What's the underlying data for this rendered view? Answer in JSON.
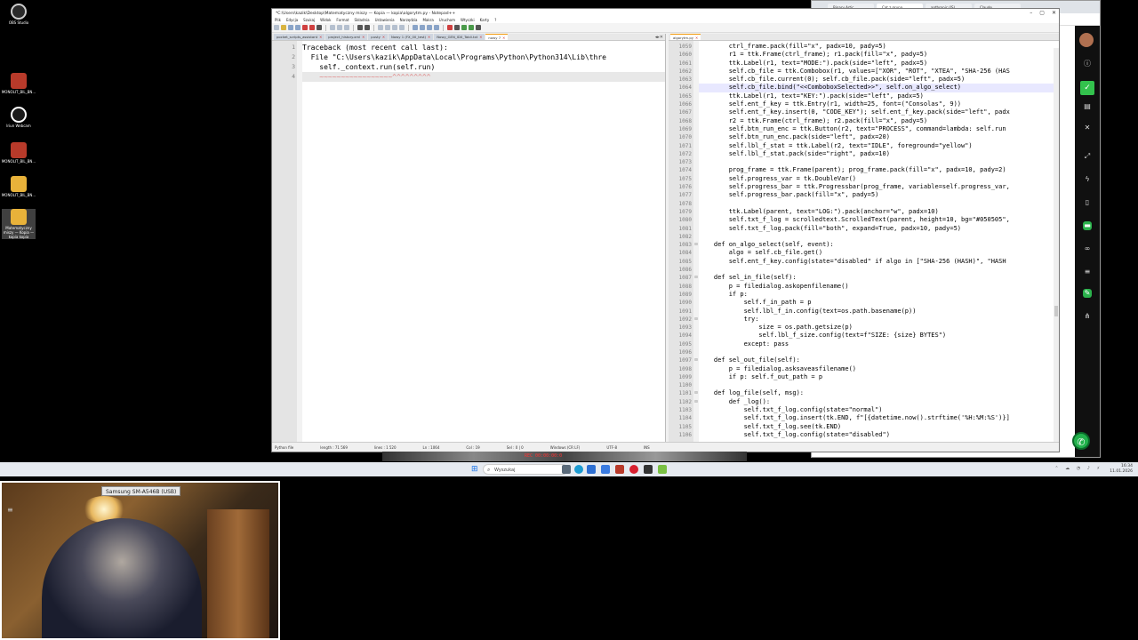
{
  "desktop": {
    "icons": [
      {
        "label": "OBS Studio",
        "color": "#2a2a2a"
      },
      {
        "label": "MONOLIT_BIL_BN...",
        "color": "#b83a2a"
      },
      {
        "label": "Iriun Webcam",
        "color": "#1a1a1a"
      },
      {
        "label": "MONOLIT_BIL_BN...",
        "color": "#b83a2a"
      },
      {
        "label": "MONOLIT_BIL_BN...",
        "color": "#e8b23a"
      },
      {
        "label": "Matematyczny miszy — Kopia — kopia kopia",
        "color": "#e8b23a"
      }
    ]
  },
  "browser": {
    "tabs": [
      "Binary Artic",
      "Cat z grupa",
      "anthropic (JS)",
      "Claude"
    ],
    "sidebar_icons": [
      "info-icon",
      "checkmark-icon",
      "notes-icon",
      "close-icon",
      "expand-icon",
      "bolt-icon",
      "doc-icon",
      "chat-icon",
      "glasses-icon",
      "list-icon",
      "wrench-icon",
      "share-icon"
    ]
  },
  "notepad": {
    "title": "*C:\\Users\\kazik\\Desktop\\Matematyczny miszy — Kopia — kopia\\algorytm.py - Notepad++",
    "menu": [
      "Plik",
      "Edycja",
      "Szukaj",
      "Widok",
      "Format",
      "Składnia",
      "Ustawienia",
      "Narzędzia",
      "Makra",
      "Uruchom",
      "Wtyczki",
      "Karty",
      "?"
    ],
    "left_tabs": [
      "pocket_scripts_assistant",
      "project_history.xml",
      "pusty",
      "Nowy 1 (FX_00_test)",
      "Nowy_GEN_IDX_Tabli.txt",
      "nowy 7"
    ],
    "right_tabs": [
      "algorytm.py"
    ],
    "left_lines": [
      {
        "n": "1",
        "t": "Traceback (most recent call last):"
      },
      {
        "n": "2",
        "t": "  File \"C:\\Users\\kazik\\AppData\\Local\\Programs\\Python\\Python314\\Lib\\thre"
      },
      {
        "n": "3",
        "t": "    self._context.run(self.run)"
      },
      {
        "n": "4",
        "t": "    ~~~~~~~~~~~~~~~~~^^^^^^^^^"
      }
    ],
    "right_lines": [
      {
        "n": "1059",
        "t": "        ctrl_frame.pack(fill=\"x\", padx=10, pady=5)"
      },
      {
        "n": "1060",
        "t": "        r1 = ttk.Frame(ctrl_frame); r1.pack(fill=\"x\", pady=5)"
      },
      {
        "n": "1061",
        "t": "        ttk.Label(r1, text=\"MODE:\").pack(side=\"left\", padx=5)"
      },
      {
        "n": "1062",
        "t": "        self.cb_file = ttk.Combobox(r1, values=[\"XOR\", \"ROT\", \"XTEA\", \"SHA-256 (HAS"
      },
      {
        "n": "1063",
        "t": "        self.cb_file.current(0); self.cb_file.pack(side=\"left\", padx=5)"
      },
      {
        "n": "1064",
        "t": "        self.cb_file.bind(\"<<ComboboxSelected>>\", self.on_algo_select)"
      },
      {
        "n": "1065",
        "t": "        ttk.Label(r1, text=\"KEY:\").pack(side=\"left\", padx=5)"
      },
      {
        "n": "1066",
        "t": "        self.ent_f_key = ttk.Entry(r1, width=25, font=(\"Consolas\", 9))"
      },
      {
        "n": "1067",
        "t": "        self.ent_f_key.insert(0, \"CODE_KEY\"); self.ent_f_key.pack(side=\"left\", padx"
      },
      {
        "n": "1068",
        "t": "        r2 = ttk.Frame(ctrl_frame); r2.pack(fill=\"x\", pady=5)"
      },
      {
        "n": "1069",
        "t": "        self.btn_run_enc = ttk.Button(r2, text=\"PROCESS\", command=lambda: self.run"
      },
      {
        "n": "1070",
        "t": "        self.btn_run_enc.pack(side=\"left\", padx=20)"
      },
      {
        "n": "1071",
        "t": "        self.lbl_f_stat = ttk.Label(r2, text=\"IDLE\", foreground=\"yellow\")"
      },
      {
        "n": "1072",
        "t": "        self.lbl_f_stat.pack(side=\"right\", padx=10)"
      },
      {
        "n": "1073",
        "t": ""
      },
      {
        "n": "1074",
        "t": "        prog_frame = ttk.Frame(parent); prog_frame.pack(fill=\"x\", padx=10, pady=2)"
      },
      {
        "n": "1075",
        "t": "        self.progress_var = tk.DoubleVar()"
      },
      {
        "n": "1076",
        "t": "        self.progress_bar = ttk.Progressbar(prog_frame, variable=self.progress_var,"
      },
      {
        "n": "1077",
        "t": "        self.progress_bar.pack(fill=\"x\", pady=5)"
      },
      {
        "n": "1078",
        "t": ""
      },
      {
        "n": "1079",
        "t": "        ttk.Label(parent, text=\"LOG:\").pack(anchor=\"w\", padx=10)"
      },
      {
        "n": "1080",
        "t": "        self.txt_f_log = scrolledtext.ScrolledText(parent, height=10, bg=\"#050505\","
      },
      {
        "n": "1081",
        "t": "        self.txt_f_log.pack(fill=\"both\", expand=True, padx=10, pady=5)"
      },
      {
        "n": "1082",
        "t": ""
      },
      {
        "n": "1083",
        "t": "    def on_algo_select(self, event):"
      },
      {
        "n": "1084",
        "t": "        algo = self.cb_file.get()"
      },
      {
        "n": "1085",
        "t": "        self.ent_f_key.config(state=\"disabled\" if algo in [\"SHA-256 (HASH)\", \"HASH"
      },
      {
        "n": "1086",
        "t": ""
      },
      {
        "n": "1087",
        "t": "    def sel_in_file(self):"
      },
      {
        "n": "1088",
        "t": "        p = filedialog.askopenfilename()"
      },
      {
        "n": "1089",
        "t": "        if p:"
      },
      {
        "n": "1090",
        "t": "            self.f_in_path = p"
      },
      {
        "n": "1091",
        "t": "            self.lbl_f_in.config(text=os.path.basename(p))"
      },
      {
        "n": "1092",
        "t": "            try:"
      },
      {
        "n": "1093",
        "t": "                size = os.path.getsize(p)"
      },
      {
        "n": "1094",
        "t": "                self.lbl_f_size.config(text=f\"SIZE: {size} BYTES\")"
      },
      {
        "n": "1095",
        "t": "            except: pass"
      },
      {
        "n": "1096",
        "t": ""
      },
      {
        "n": "1097",
        "t": "    def sel_out_file(self):"
      },
      {
        "n": "1098",
        "t": "        p = filedialog.asksaveasfilename()"
      },
      {
        "n": "1099",
        "t": "        if p: self.f_out_path = p"
      },
      {
        "n": "1100",
        "t": ""
      },
      {
        "n": "1101",
        "t": "    def log_file(self, msg):"
      },
      {
        "n": "1102",
        "t": "        def _log():"
      },
      {
        "n": "1103",
        "t": "            self.txt_f_log.config(state=\"normal\")"
      },
      {
        "n": "1104",
        "t": "            self.txt_f_log.insert(tk.END, f\"[{datetime.now().strftime('%H:%M:%S')}]"
      },
      {
        "n": "1105",
        "t": "            self.txt_f_log.see(tk.END)"
      },
      {
        "n": "1106",
        "t": "            self.txt_f_log.config(state=\"disabled\")"
      }
    ],
    "status_left": "Python file",
    "status_items": [
      "length : 71 569",
      "lines : 1 520",
      "Ln : 1064",
      "Col : 19",
      "Sel : 0 | 0",
      "Windows (CR LF)",
      "UTF-8",
      "INS"
    ]
  },
  "taskbar": {
    "search_placeholder": "Wyszukaj",
    "time": "16:34",
    "date": "11.01.2026"
  },
  "webcam": {
    "device_label": "Samsung SM-A546B (USB)"
  },
  "obs_strip_text": "REC 00:00:00:0"
}
